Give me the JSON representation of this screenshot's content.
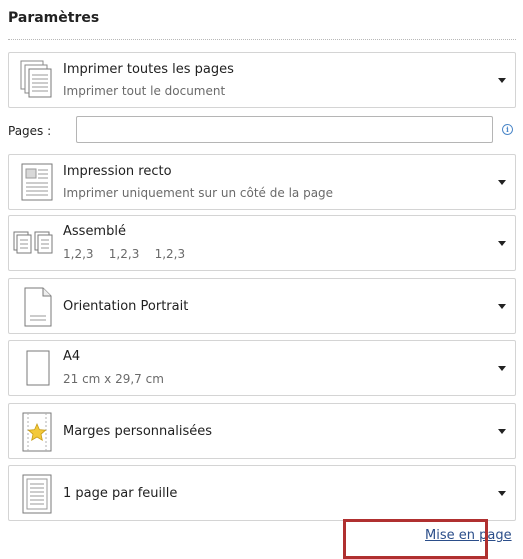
{
  "panel": {
    "title": "Paramètres"
  },
  "print_what": {
    "label": "Imprimer toutes les pages",
    "sub": "Imprimer tout le document",
    "icon": "document-stack-icon"
  },
  "pages": {
    "label": "Pages :",
    "value": "",
    "info_icon": "info-icon"
  },
  "sides": {
    "label": "Impression recto",
    "sub": "Imprimer uniquement sur un côté de la page",
    "icon": "single-sided-icon"
  },
  "collate": {
    "label": "Assemblé",
    "sub": "1,2,3    1,2,3    1,2,3",
    "icon": "collated-icon"
  },
  "orientation": {
    "label": "Orientation Portrait",
    "icon": "portrait-page-icon"
  },
  "paper": {
    "label": "A4",
    "sub": "21 cm x 29,7 cm",
    "icon": "paper-size-icon"
  },
  "margins": {
    "label": "Marges personnalisées",
    "icon": "custom-margins-icon"
  },
  "pages_per_sheet": {
    "label": "1 page par feuille",
    "icon": "one-page-per-sheet-icon"
  },
  "page_setup_link": {
    "label": "Mise en page"
  },
  "colors": {
    "highlight": "#b03030",
    "link": "#2b4e8a"
  }
}
